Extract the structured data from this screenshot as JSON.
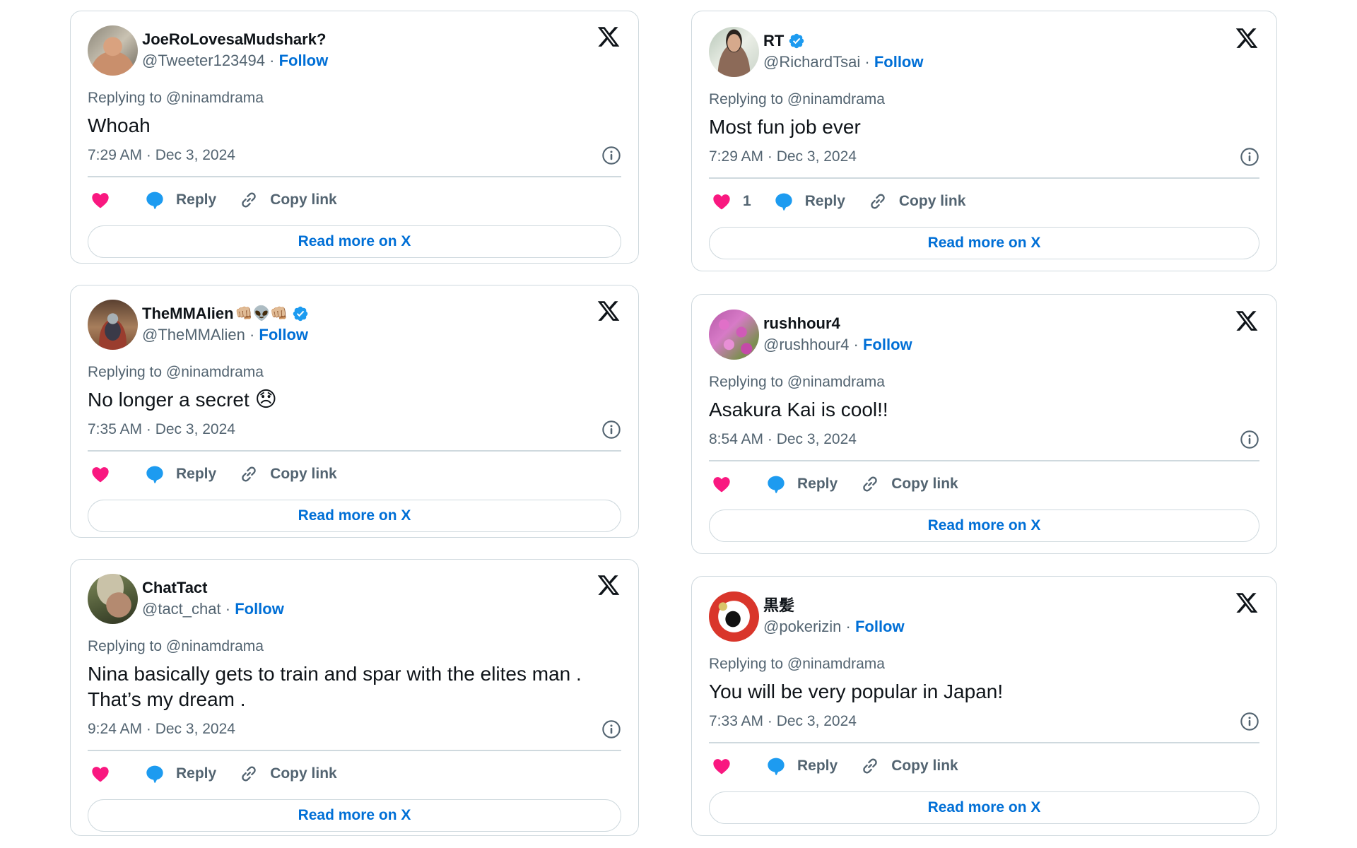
{
  "colors": {
    "like": "#F91880",
    "reply": "#1D9BF0",
    "link": "#006FD6",
    "verified": "#1D9BF0",
    "secondary_text": "#536471",
    "border": "#CFD9DE"
  },
  "labels": {
    "follow": "Follow",
    "reply": "Reply",
    "copy_link": "Copy link",
    "read_more": "Read more on X",
    "separator": " · "
  },
  "tweets": [
    {
      "display_name": "JoeRoLovesaMudshark?",
      "name_emojis": "",
      "verified": false,
      "handle": "@Tweeter123494",
      "replying_to": "Replying to @ninamdrama",
      "text": "Whoah",
      "text_emoji": "",
      "timestamp": "7:29 AM · Dec 3, 2024",
      "like_count": "",
      "avatar": "avatar-man-shirtless"
    },
    {
      "display_name": "TheMMAlien",
      "name_emojis": "👊🏼👽👊🏼",
      "verified": true,
      "handle": "@TheMMAlien",
      "replying_to": "Replying to @ninamdrama",
      "text": "No longer a secret ",
      "text_emoji": "😞",
      "timestamp": "7:35 AM · Dec 3, 2024",
      "like_count": "",
      "avatar": "avatar-alien-meditating"
    },
    {
      "display_name": "ChatTact",
      "name_emojis": "",
      "verified": false,
      "handle": "@tact_chat",
      "replying_to": "Replying to @ninamdrama",
      "text": "Nina basically gets to train and spar with the elites man . That’s my dream .",
      "text_emoji": "",
      "timestamp": "9:24 AM · Dec 3, 2024",
      "like_count": "",
      "avatar": "avatar-man-hat"
    },
    {
      "display_name": "RT",
      "name_emojis": "",
      "verified": true,
      "handle": "@RichardTsai",
      "replying_to": "Replying to @ninamdrama",
      "text": "Most fun job ever",
      "text_emoji": "",
      "timestamp": "7:29 AM · Dec 3, 2024",
      "like_count": "1",
      "avatar": "avatar-man-suit"
    },
    {
      "display_name": "rushhour4",
      "name_emojis": "",
      "verified": false,
      "handle": "@rushhour4",
      "replying_to": "Replying to @ninamdrama",
      "text": "Asakura Kai is cool!!",
      "text_emoji": "",
      "timestamp": "8:54 AM · Dec 3, 2024",
      "like_count": "",
      "avatar": "avatar-pink-flowers"
    },
    {
      "display_name": "黒髪",
      "name_emojis": "",
      "verified": false,
      "handle": "@pokerizin",
      "replying_to": "Replying to @ninamdrama",
      "text": "You will be very popular in Japan!",
      "text_emoji": "",
      "timestamp": "7:33 AM · Dec 3, 2024",
      "like_count": "",
      "avatar": "avatar-flower-thrower"
    }
  ]
}
